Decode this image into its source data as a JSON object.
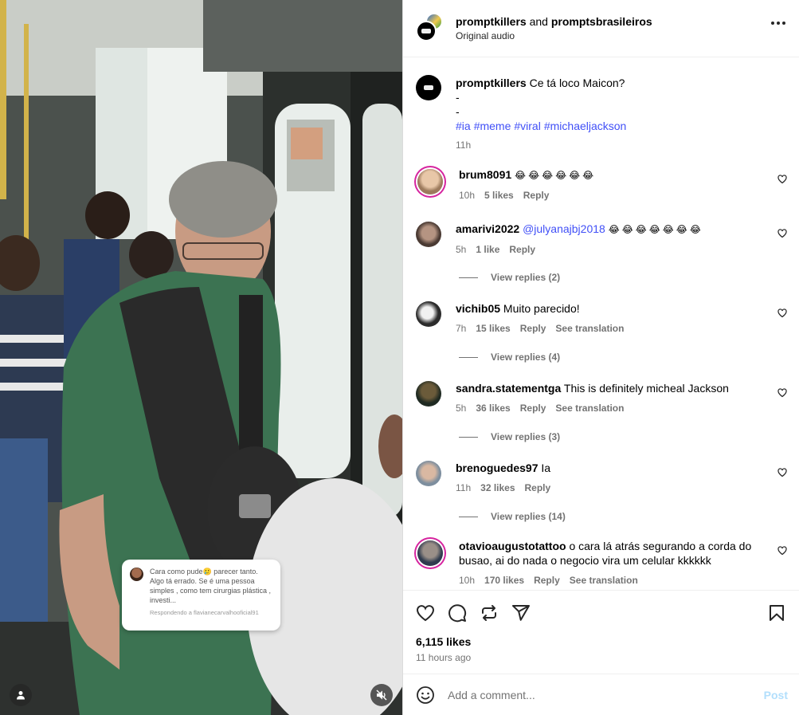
{
  "header": {
    "user1": "promptkillers",
    "connector": " and ",
    "user2": "promptsbrasileiros",
    "subtitle": "Original audio"
  },
  "caption": {
    "username": "promptkillers",
    "text": "Ce tá loco Maicon?",
    "line2": "-",
    "line3": "-",
    "hashtags": [
      "#ia",
      "#meme",
      "#viral",
      "#michaeljackson"
    ],
    "time": "11h"
  },
  "comments": [
    {
      "username": "brum8091",
      "text": "😂😂😂😂😂😂",
      "mention": "",
      "time": "10h",
      "likes": "5 likes",
      "reply": "Reply",
      "translation": "",
      "replies": ""
    },
    {
      "username": "amarivi2022",
      "mention": "@julyanajbj2018",
      "text": "😂😂😂😂😂😂😂",
      "time": "5h",
      "likes": "1 like",
      "reply": "Reply",
      "translation": "",
      "replies": "View replies (2)"
    },
    {
      "username": "vichib05",
      "mention": "",
      "text": "Muito parecido!",
      "time": "7h",
      "likes": "15 likes",
      "reply": "Reply",
      "translation": "See translation",
      "replies": "View replies (4)"
    },
    {
      "username": "sandra.statementga",
      "mention": "",
      "text": "This is definitely micheal Jackson",
      "time": "5h",
      "likes": "36 likes",
      "reply": "Reply",
      "translation": "See translation",
      "replies": "View replies (3)"
    },
    {
      "username": "brenoguedes97",
      "mention": "",
      "text": "Ia",
      "time": "11h",
      "likes": "32 likes",
      "reply": "Reply",
      "translation": "",
      "replies": "View replies (14)"
    },
    {
      "username": "otavioaugustotattoo",
      "mention": "",
      "text": "o cara lá atrás segurando a corda do busao, ai do nada o negocio vira um celular kkkkkk",
      "time": "10h",
      "likes": "170 likes",
      "reply": "Reply",
      "translation": "See translation",
      "replies": ""
    }
  ],
  "actions": {
    "likes": "6,115 likes",
    "time_ago": "11 hours ago"
  },
  "add_comment": {
    "placeholder": "Add a comment...",
    "post": "Post"
  },
  "media_overlay": {
    "reply_text": "Cara como pude🥲 parecer tanto. Algo tá errado. Se é uma pessoa simples , como tem cirurgias plástica , investi...",
    "reply_meta": "Respondendo a flavianecarvalhooficial91"
  },
  "colors": {
    "link": "#4150f7",
    "secondary_text": "#737373",
    "post_disabled": "#b2dffc",
    "story_ring": "#d6249f"
  }
}
